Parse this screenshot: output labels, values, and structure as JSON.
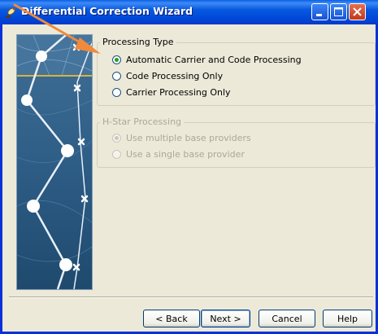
{
  "window": {
    "title": "Differential Correction Wizard",
    "app_icon": "satellite-dish-icon",
    "controls": [
      "minimize-icon",
      "maximize-icon",
      "close-icon"
    ]
  },
  "processing_type": {
    "legend": "Processing Type",
    "options": [
      {
        "label": "Automatic Carrier and Code Processing",
        "selected": true
      },
      {
        "label": "Code Processing Only",
        "selected": false
      },
      {
        "label": "Carrier Processing Only",
        "selected": false
      }
    ]
  },
  "hstar_processing": {
    "legend": "H-Star Processing",
    "enabled": false,
    "options": [
      {
        "label": "Use multiple base providers",
        "selected": true
      },
      {
        "label": "Use a single base provider",
        "selected": false
      }
    ]
  },
  "buttons": {
    "back": "< Back",
    "next": "Next >",
    "cancel": "Cancel",
    "help": "Help"
  },
  "annotation": {
    "icon": "arrow-annotation",
    "color": "#F08A3C"
  },
  "colors": {
    "titlebar": "#0A5FE8",
    "dialog_bg": "#ECE9D8",
    "radio_check": "#21A121"
  }
}
